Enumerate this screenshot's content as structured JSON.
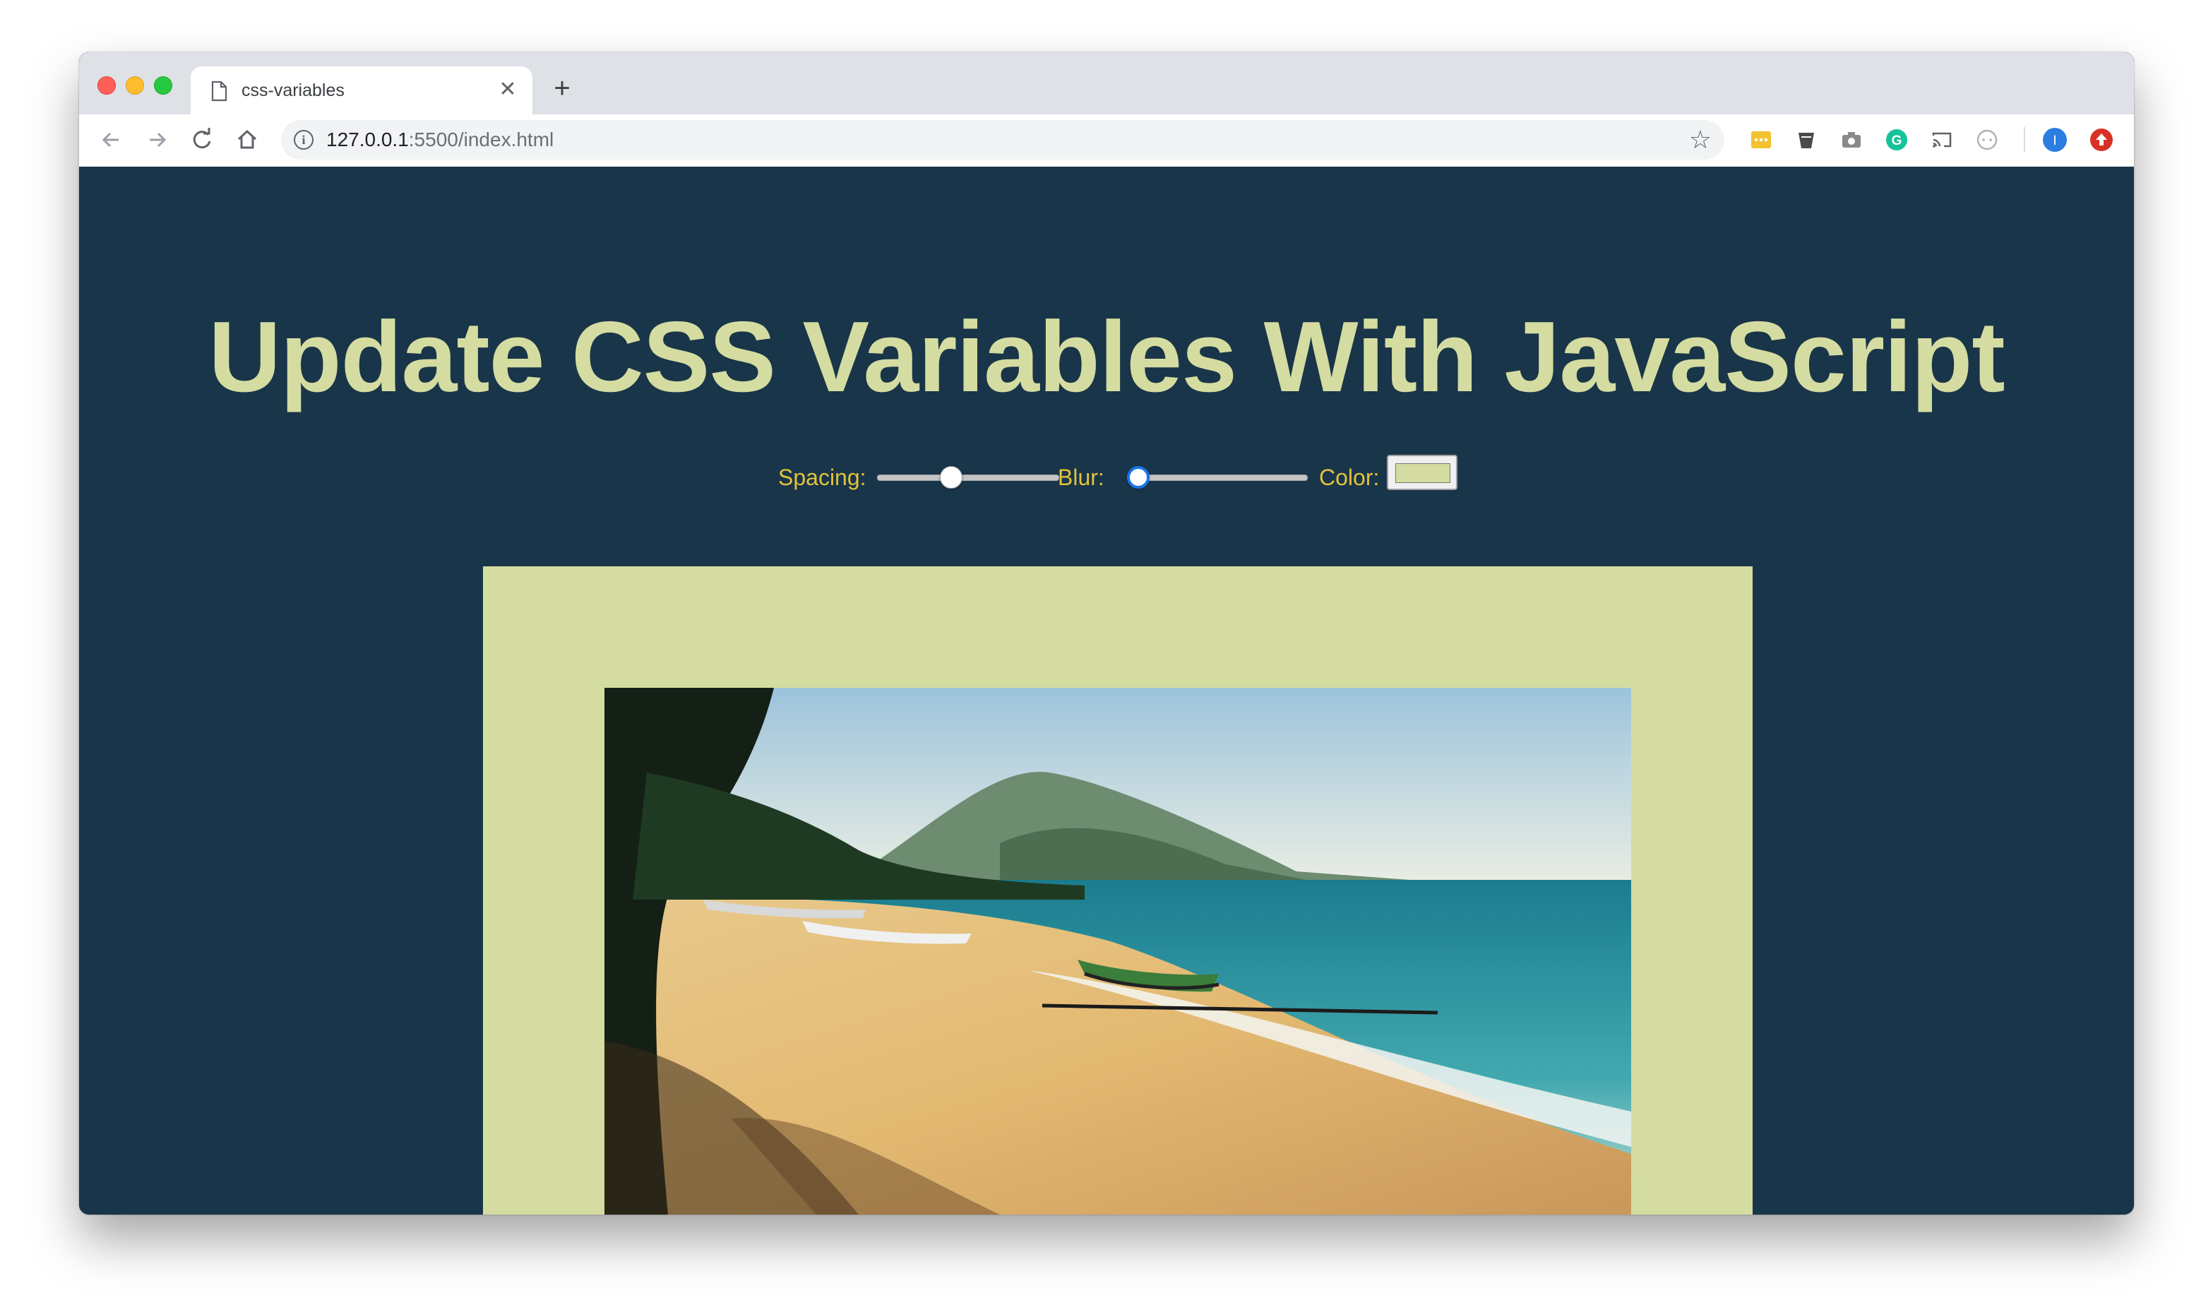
{
  "browser": {
    "tab_title": "css-variables",
    "url_host": "127.0.0.1",
    "url_rest": ":5500/index.html",
    "profile_initial": "I"
  },
  "page": {
    "heading": "Update CSS Variables With JavaScript",
    "controls": {
      "spacing_label": "Spacing:",
      "spacing_value": 0.4,
      "blur_label": "Blur:",
      "blur_value": 0,
      "color_label": "Color:",
      "color_value": "#d5dca1"
    },
    "colors": {
      "background": "#193549",
      "heading": "#d5dca1",
      "label": "#e2c23d",
      "frame": "#d5dca1"
    }
  },
  "icons": {
    "tab_favicon": "document-icon",
    "tab_close": "close-icon",
    "new_tab": "plus-icon",
    "back": "back-arrow-icon",
    "forward": "forward-arrow-icon",
    "reload": "reload-icon",
    "home": "home-icon",
    "site_info": "info-icon",
    "bookmark": "star-icon"
  }
}
